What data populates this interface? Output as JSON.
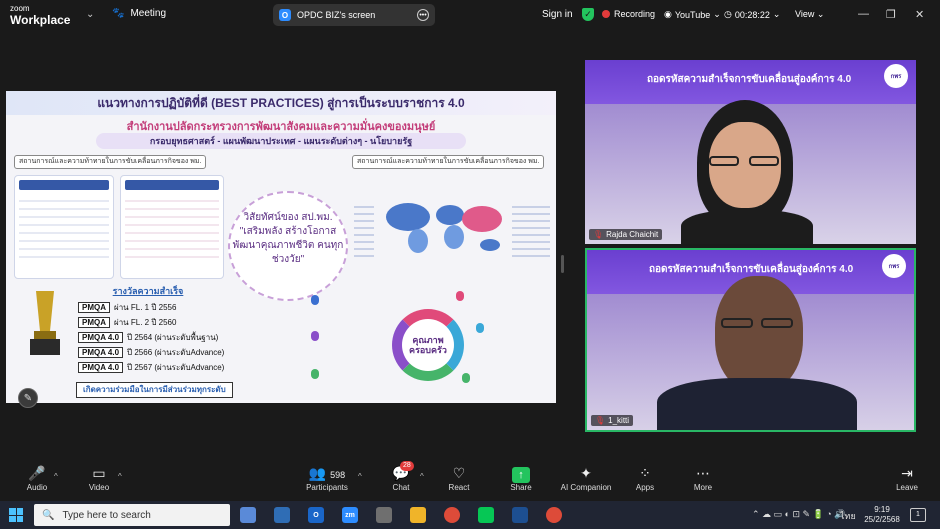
{
  "app": {
    "logo_line1": "zoom",
    "logo_line2": "Workplace",
    "meeting_label": "Meeting"
  },
  "share_pill": {
    "initial": "O",
    "label": "OPDC BIZ's screen"
  },
  "header": {
    "signin": "Sign in",
    "recording": "Recording",
    "youtube": "YouTube",
    "timer": "00:28:22",
    "view": "View"
  },
  "slide": {
    "title": "แนวทางการปฏิบัติที่ดี (BEST PRACTICES) สู่การเป็นระบบราชการ 4.0",
    "subtitle": "สำนักงานปลัดกระทรวงการพัฒนาสังคมและความมั่นคงของมนุษย์",
    "subtitle2": "กรอบยุทธศาสตร์ - แผนพัฒนาประเทศ - แผนระดับต่างๆ - นโยบายรัฐ",
    "left_head": "สถานการณ์และความท้าทายในการขับเคลื่อนภารกิจของ พม.",
    "right_head": "สถานการณ์และความท้าทายในการขับเคลื่อนภารกิจของ พม.",
    "vision": "วิสัยทัศน์ของ สป.พม. \"เสริมพลัง สร้างโอกาส พัฒนาคุณภาพชีวิต คนทุกช่วงวัย\"",
    "award_title": "รางวัลความสำเร็จ",
    "awards": [
      {
        "tag": "PMQA",
        "text": "ผ่าน FL. 1 ปี 2556"
      },
      {
        "tag": "PMQA",
        "text": "ผ่าน FL. 2 ปี 2560"
      },
      {
        "tag": "PMQA 4.0",
        "text": "ปี 2564 (ผ่านระดับพื้นฐาน)"
      },
      {
        "tag": "PMQA 4.0",
        "text": "ปี 2566 (ผ่านระดับAdvance)"
      },
      {
        "tag": "PMQA 4.0",
        "text": "ปี 2567 (ผ่านระดับAdvance)"
      }
    ],
    "footer": "เกิดความร่วมมือในการมีส่วนร่วมทุกระดับ",
    "ring_label": "คุณภาพ ครอบครัว"
  },
  "videos": [
    {
      "banner": "ถอดรหัสความสำเร็จการขับเคลื่อนสู่องค์การ 4.0",
      "logo": "กพร",
      "name": "Rajda Chaichit"
    },
    {
      "banner": "ถอดรหัสความสำเร็จการขับเคลื่อนสู่องค์การ 4.0",
      "logo": "กพร",
      "name": "1_kitti"
    }
  ],
  "toolbar": {
    "audio": "Audio",
    "video": "Video",
    "participants": "Participants",
    "participants_count": "598",
    "chat": "Chat",
    "chat_badge": "28",
    "react": "React",
    "share": "Share",
    "ai": "AI Companion",
    "apps": "Apps",
    "more": "More",
    "leave": "Leave"
  },
  "taskbar": {
    "search_placeholder": "Type here to search",
    "lang": "ไทย",
    "time": "9:19",
    "date": "25/2/2568",
    "notif": "1"
  },
  "colors": {
    "accent_green": "#23c45e",
    "record_red": "#e23b3b",
    "banner_purple": "#7a4fd6"
  }
}
